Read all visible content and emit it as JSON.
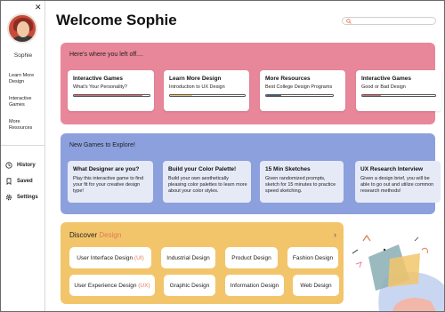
{
  "user": {
    "name": "Sophie"
  },
  "sidebar": {
    "nav": [
      {
        "label": "Learn More Design"
      },
      {
        "label": "Interactive Games"
      },
      {
        "label": "More Resources"
      }
    ],
    "bottom": [
      {
        "label": "History",
        "icon": "clock-icon"
      },
      {
        "label": "Saved",
        "icon": "bookmark-icon"
      },
      {
        "label": "Settings",
        "icon": "gear-icon"
      }
    ]
  },
  "header": {
    "title": "Welcome Sophie"
  },
  "search": {
    "placeholder": ""
  },
  "left_off": {
    "title": "Here's where you left off....",
    "cards": [
      {
        "title": "Interactive Games",
        "subtitle": "What's Your Personality?",
        "progress": 0.9,
        "color": "#d96a74"
      },
      {
        "title": "Learn More Design",
        "subtitle": "Introduction to UX Design",
        "progress": 0.3,
        "color": "#f2c56b"
      },
      {
        "title": "More Resources",
        "subtitle": "Best College Design Programs",
        "progress": 0.22,
        "color": "#3f5f7a"
      },
      {
        "title": "Interactive Games",
        "subtitle": "Good or Bad Design",
        "progress": 0.25,
        "color": "#d96a74"
      }
    ]
  },
  "games": {
    "title": "New Games to Explore!",
    "cards": [
      {
        "title": "What Designer are you?",
        "desc": "Play this interactive game to find your fit for your creative design type!"
      },
      {
        "title": "Build your Color Palette!",
        "desc": "Build your own aesthetically pleasing color palettes to learn more about your color styles."
      },
      {
        "title": "15 Min Sketches",
        "desc": "Given randomized prompts, sketch for 15 minutes to practice speed sketching."
      },
      {
        "title": "UX Research Interview",
        "desc": "Given a design brief, you will be able to go out and utilize common research methods!"
      }
    ]
  },
  "discover": {
    "title": "Discover",
    "accent": "Design",
    "chevron": "›",
    "pills": [
      {
        "label": "User Interface Design",
        "tag": "(UI)"
      },
      {
        "label": "Industrial Design",
        "tag": ""
      },
      {
        "label": "Product Design",
        "tag": ""
      },
      {
        "label": "Fashion Design",
        "tag": ""
      },
      {
        "label": "User Experience Design",
        "tag": "(UX)"
      },
      {
        "label": "Graphic Design",
        "tag": ""
      },
      {
        "label": "Information Design",
        "tag": ""
      },
      {
        "label": "Web Design",
        "tag": ""
      }
    ]
  },
  "colors": {
    "pink": "#e8879a",
    "blue": "#8ca0dd",
    "yellow": "#f2c56b",
    "accent": "#e07a58"
  }
}
